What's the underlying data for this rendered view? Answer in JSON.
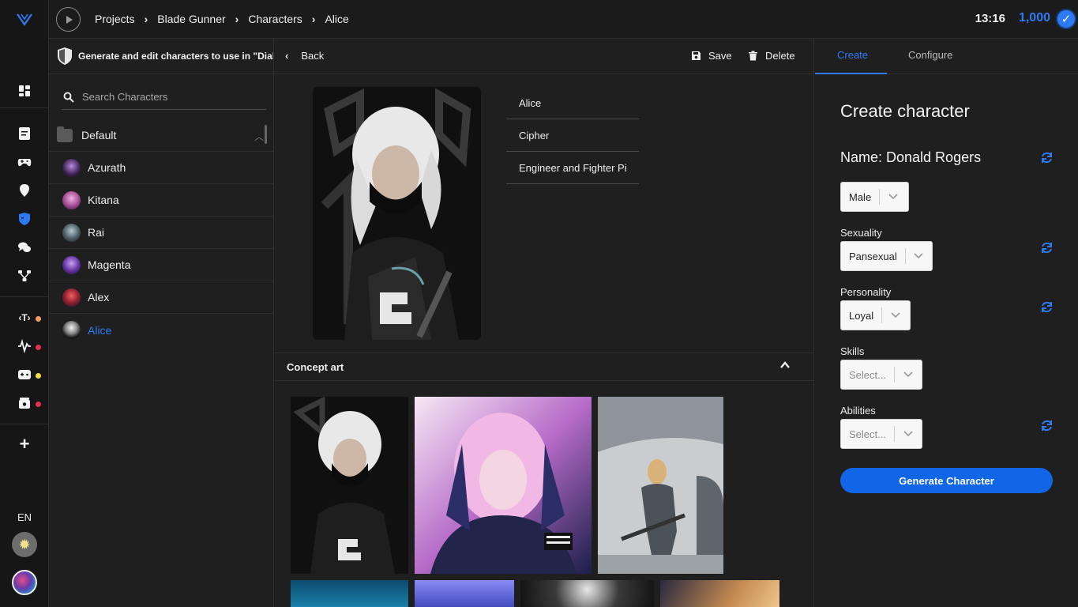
{
  "app": {
    "breadcrumbs": [
      "Projects",
      "Blade Gunner",
      "Characters",
      "Alice"
    ],
    "clock": "13:16",
    "credits": "1,000",
    "language": "EN"
  },
  "colors": {
    "accent": "#2d7bf4",
    "button": "#1166e8",
    "dot_orange": "#f0a066",
    "dot_red": "#e5305a",
    "dot_yellow": "#f3e03a"
  },
  "sidebar_icons": [
    "dashboard-icon",
    "document-icon",
    "gamepad-icon",
    "location-pin-icon",
    "shield-mask-icon",
    "chat-bubbles-icon",
    "node-graph-icon",
    "text-tag-icon",
    "waveform-icon",
    "game-controller-icon",
    "box-icon",
    "plus-icon",
    "gear-icon"
  ],
  "list_panel": {
    "header": "Generate and edit characters to use in \"Dialog",
    "search_placeholder": "Search Characters",
    "folder": "Default",
    "characters": [
      "Azurath",
      "Kitana",
      "Rai",
      "Magenta",
      "Alex",
      "Alice"
    ]
  },
  "editor": {
    "back_label": "Back",
    "save_label": "Save",
    "delete_label": "Delete",
    "fields": [
      "Alice",
      "Cipher",
      "Engineer and Fighter Pi"
    ],
    "concept_art_label": "Concept art"
  },
  "create_panel": {
    "tabs": [
      "Create",
      "Configure"
    ],
    "title": "Create character",
    "name_line": "Name: Donald Rogers",
    "gender": "Male",
    "sexuality_label": "Sexuality",
    "sexuality": "Pansexual",
    "personality_label": "Personality",
    "personality": "Loyal",
    "skills_label": "Skills",
    "skills_placeholder": "Select...",
    "abilities_label": "Abilities",
    "abilities_placeholder": "Select...",
    "generate_label": "Generate Character"
  }
}
